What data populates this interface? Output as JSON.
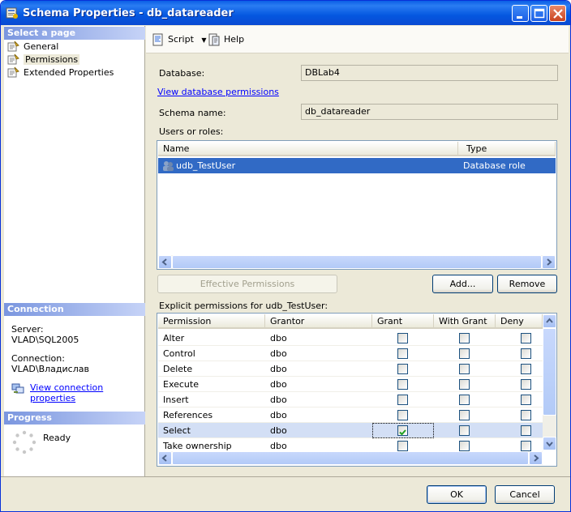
{
  "window": {
    "title": "Schema Properties - db_datareader",
    "controls": [
      "minimize",
      "maximize",
      "close"
    ]
  },
  "left_pane": {
    "select_page_header": "Select a page",
    "pages": [
      {
        "label": "General",
        "icon": "property-page-icon",
        "selected": false
      },
      {
        "label": "Permissions",
        "icon": "property-page-icon",
        "selected": true
      },
      {
        "label": "Extended Properties",
        "icon": "property-page-icon",
        "selected": false
      }
    ],
    "connection_header": "Connection",
    "server_label": "Server:",
    "server_value": "VLAD\\SQL2005",
    "connection_label": "Connection:",
    "connection_value": "VLAD\\Владислав",
    "view_connection_link": "View connection properties",
    "progress_header": "Progress",
    "progress_status": "Ready"
  },
  "toolbar": {
    "script_label": "Script",
    "help_label": "Help"
  },
  "form": {
    "database_label": "Database:",
    "database_value": "DBLab4",
    "view_db_permissions_link": "View database permissions",
    "schema_name_label": "Schema name:",
    "schema_name_value": "db_datareader",
    "users_or_roles_label": "Users or roles:",
    "users_columns": [
      "Name",
      "Type"
    ],
    "users_rows": [
      {
        "name": "udb_TestUser",
        "type": "Database role",
        "selected": true
      }
    ],
    "effective_permissions_button": "Effective Permissions",
    "add_button": "Add...",
    "remove_button": "Remove",
    "explicit_permissions_label": "Explicit permissions for udb_TestUser:",
    "perm_columns": [
      "Permission",
      "Grantor",
      "Grant",
      "With Grant",
      "Deny"
    ],
    "perm_rows": [
      {
        "permission": "Alter",
        "grantor": "dbo",
        "grant": false,
        "with_grant": false,
        "deny": false
      },
      {
        "permission": "Control",
        "grantor": "dbo",
        "grant": false,
        "with_grant": false,
        "deny": false
      },
      {
        "permission": "Delete",
        "grantor": "dbo",
        "grant": false,
        "with_grant": false,
        "deny": false
      },
      {
        "permission": "Execute",
        "grantor": "dbo",
        "grant": false,
        "with_grant": false,
        "deny": false
      },
      {
        "permission": "Insert",
        "grantor": "dbo",
        "grant": false,
        "with_grant": false,
        "deny": false
      },
      {
        "permission": "References",
        "grantor": "dbo",
        "grant": false,
        "with_grant": false,
        "deny": false
      },
      {
        "permission": "Select",
        "grantor": "dbo",
        "grant": true,
        "with_grant": false,
        "deny": false,
        "selected": true
      },
      {
        "permission": "Take ownership",
        "grantor": "dbo",
        "grant": false,
        "with_grant": false,
        "deny": false
      }
    ]
  },
  "footer": {
    "ok_button": "OK",
    "cancel_button": "Cancel"
  },
  "colors": {
    "titlebar": "#0a5ee6",
    "selection": "#316ac5",
    "link": "#0000ff",
    "check": "#21a121"
  }
}
